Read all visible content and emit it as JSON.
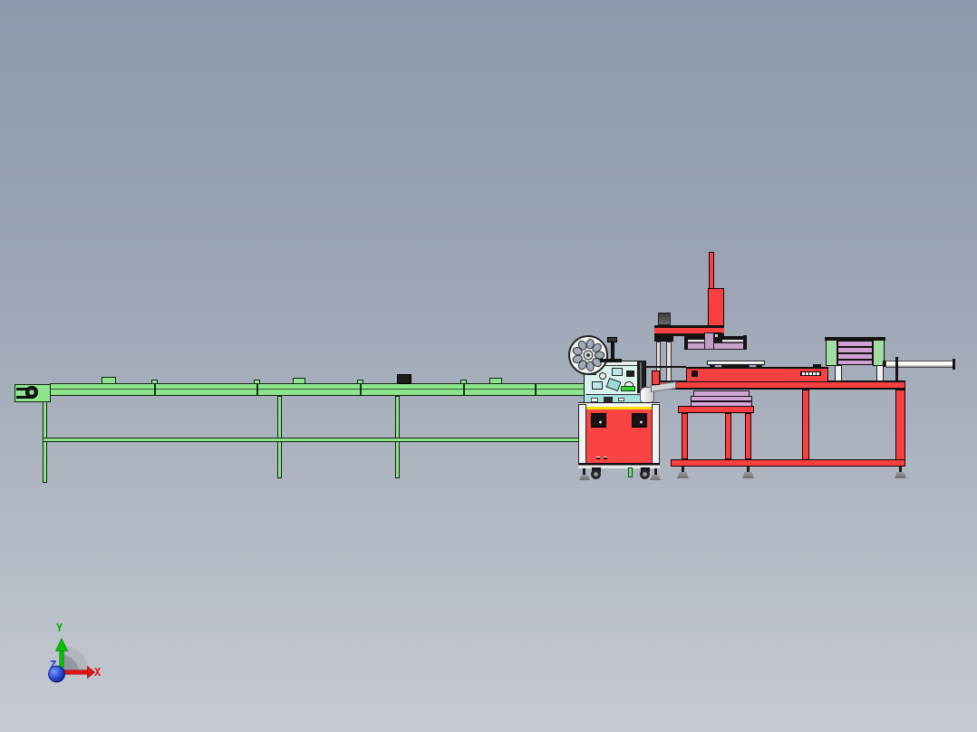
{
  "viewport": {
    "app_type": "3d-cad-model-viewport",
    "background_top_color": "#8d99ac",
    "background_bottom_color": "#c6cad1"
  },
  "origin_triad": {
    "y_axis_label": "Y",
    "x_axis_label": "X",
    "z_axis_label": "Z",
    "y_axis_color": "#00b400",
    "x_axis_color": "#e81414",
    "z_axis_color": "#2547cf"
  },
  "model": {
    "scene": "automatic-feeding-and-packing-machine-line-side-view",
    "components": {
      "infeed_conveyor": {
        "color": "#8ee48c"
      },
      "wrapping_machine_cabinet": {
        "body_color": "#f94040",
        "top_stripe_color": "#f0e202",
        "panel_color": "#d8f2f0"
      },
      "film_reel": {
        "color": "#f2f2f2"
      },
      "gantry_column": {
        "color": "#f94040"
      },
      "linear_slide": {
        "color": "#c9a1cb"
      },
      "outfeed_table_frame": {
        "color": "#f94040"
      },
      "tray_stack": {
        "color": "#d2a6d6"
      },
      "slat_magazine": {
        "cap_color": "#a2dca2",
        "slat_color": "#d0a0d4"
      },
      "guide_rod": {
        "color": "#f4f4f4"
      }
    }
  }
}
